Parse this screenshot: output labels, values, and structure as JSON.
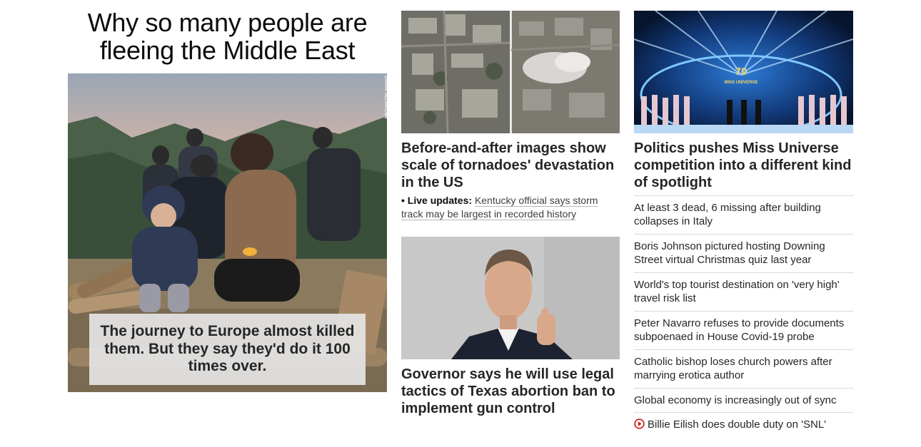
{
  "lead": {
    "headline": "Why so many people are fleeing the Middle East",
    "photo_credit": "ZAHRA ULLAH/CNN",
    "caption": "The journey to Europe almost killed them. But they say they'd do it 100 times over."
  },
  "center": {
    "story1": {
      "headline": "Before-and-after images show scale of tornadoes' devastation in the US",
      "live_label": "Live updates:",
      "live_text": "Kentucky official says storm track may be largest in recorded history"
    },
    "story2": {
      "headline": "Governor says he will use legal tactics of Texas abortion ban to implement gun control"
    }
  },
  "right": {
    "feature": {
      "headline": "Politics pushes Miss Universe competition into a different kind of spotlight",
      "image_overlay": "70 MISS UNIVERSE"
    },
    "stories": [
      "At least 3 dead, 6 missing after building collapses in Italy",
      "Boris Johnson pictured hosting Downing Street virtual Christmas quiz last year",
      "World's top tourist destination on 'very high' travel risk list",
      "Peter Navarro refuses to provide documents subpoenaed in House Covid-19 probe",
      "Catholic bishop loses church powers after marrying erotica author",
      "Global economy is increasingly out of sync",
      "Billie Eilish does double duty on 'SNL'"
    ]
  },
  "colors": {
    "text": "#0c0c0c",
    "headline": "#262626",
    "divider": "#d8d8d8",
    "video_icon": "#cc0000",
    "caption_bg": "#e5e5e5"
  },
  "icons": {
    "video": "play-circle-icon"
  }
}
